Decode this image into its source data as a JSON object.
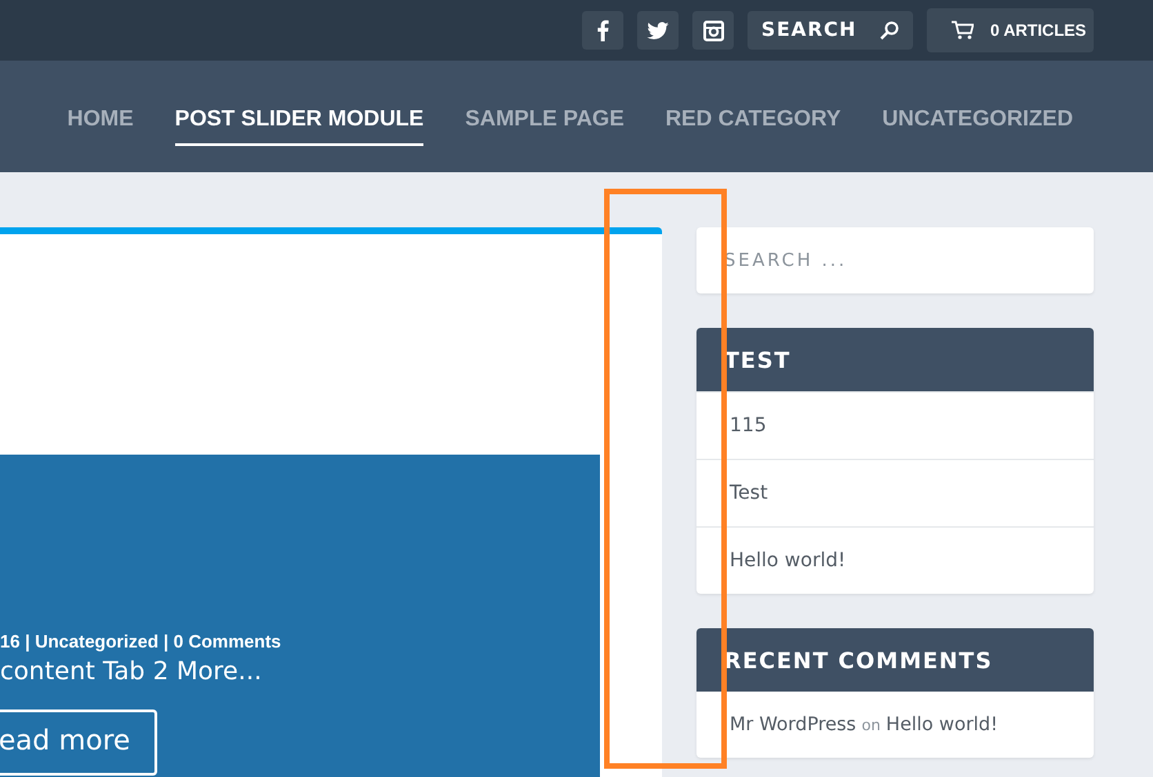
{
  "top_bar": {
    "search": {
      "placeholder": "SEARCH"
    },
    "cart": {
      "label": "0 ARTICLES"
    }
  },
  "nav": [
    {
      "label": "HOME",
      "selected": false
    },
    {
      "label": "POST SLIDER MODULE",
      "selected": true
    },
    {
      "label": "SAMPLE PAGE",
      "selected": false
    },
    {
      "label": "RED CATEGORY",
      "selected": false
    },
    {
      "label": "UNCATEGORIZED",
      "selected": false
    }
  ],
  "post": {
    "meta": "16 | Uncategorized | 0 Comments",
    "excerpt": "content Tab 2 More...",
    "button": "ead more"
  },
  "sidebar": {
    "search": {
      "placeholder": "SEARCH ..."
    },
    "widgets": [
      {
        "kind": "list",
        "title": "TEST",
        "items": [
          "115",
          "Test",
          "Hello world!"
        ]
      },
      {
        "kind": "comments",
        "title": "RECENT COMMENTS",
        "comments": [
          {
            "author": "Mr WordPress",
            "on": "on",
            "post": "Hello world!"
          }
        ]
      }
    ]
  }
}
